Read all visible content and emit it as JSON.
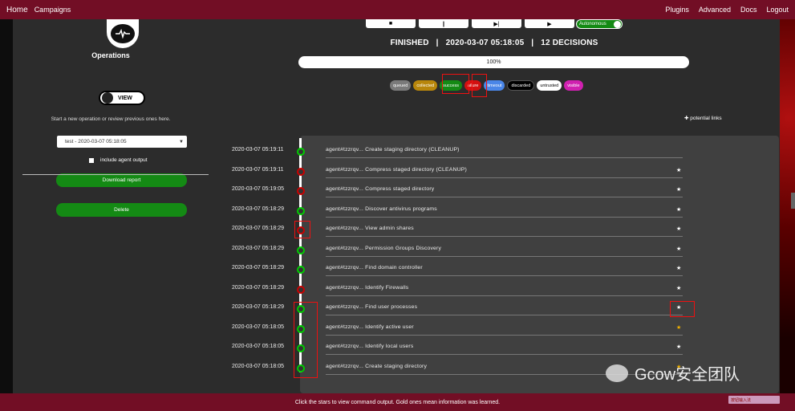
{
  "topnav": {
    "left": [
      "Home",
      "Campaigns"
    ],
    "right": [
      "Plugins",
      "Advanced",
      "Docs",
      "Logout"
    ]
  },
  "left": {
    "title": "Operations",
    "view_label": "VIEW",
    "start_text": "Start a new operation or review previous ones here.",
    "selected_op": "test - 2020-03-07 05:18:05",
    "include_label": "include agent output",
    "download_label": "Download report",
    "delete_label": "Delete"
  },
  "main": {
    "controls": [
      "■",
      "∥",
      "▶|",
      "▶"
    ],
    "autonomous_label": "Autonomous",
    "status": "FINISHED   |   2020-03-07 05:18:05   |   12 DECISIONS",
    "progress": "100%",
    "chips": [
      {
        "label": "queued",
        "color": "#7a7a7a"
      },
      {
        "label": "collected",
        "color": "#b8860b"
      },
      {
        "label": "success",
        "color": "#148a14"
      },
      {
        "label": "ailure",
        "color": "#d21010"
      },
      {
        "label": "timeout",
        "color": "#4a86e8"
      },
      {
        "label": "discarded",
        "color": "#000000"
      },
      {
        "label": "untrusted",
        "color": "#ffffff"
      },
      {
        "label": "visible",
        "color": "#d020b0"
      }
    ],
    "potential_links": "✚ potential links",
    "rows": [
      {
        "date": "2020-03-07 05:19:11",
        "text": "agent#tzzrqv... Create staging directory (CLEANUP)",
        "status": "success",
        "star": ""
      },
      {
        "date": "2020-03-07 05:19:11",
        "text": "agent#tzzrqv... Compress staged directory (CLEANUP)",
        "status": "failure",
        "star": "★"
      },
      {
        "date": "2020-03-07 05:19:05",
        "text": "agent#tzzrqv... Compress staged directory",
        "status": "failure",
        "star": "★"
      },
      {
        "date": "2020-03-07 05:18:29",
        "text": "agent#tzzrqv... Discover antivirus programs",
        "status": "success",
        "star": "★"
      },
      {
        "date": "2020-03-07 05:18:29",
        "text": "agent#tzzrqv... View admin shares",
        "status": "failure",
        "star": "★"
      },
      {
        "date": "2020-03-07 05:18:29",
        "text": "agent#tzzrqv... Permission Groups Discovery",
        "status": "success",
        "star": "★"
      },
      {
        "date": "2020-03-07 05:18:29",
        "text": "agent#tzzrqv... Find domain controller",
        "status": "success",
        "star": "★"
      },
      {
        "date": "2020-03-07 05:18:29",
        "text": "agent#tzzrqv... Identify Firewalls",
        "status": "failure",
        "star": "★"
      },
      {
        "date": "2020-03-07 05:18:29",
        "text": "agent#tzzrqv... Find user processes",
        "status": "success",
        "star": "★"
      },
      {
        "date": "2020-03-07 05:18:05",
        "text": "agent#tzzrqv... Identify active user",
        "status": "success",
        "star": "★",
        "gold": true
      },
      {
        "date": "2020-03-07 05:18:05",
        "text": "agent#tzzrqv... Identify local users",
        "status": "success",
        "star": "★"
      },
      {
        "date": "2020-03-07 05:18:05",
        "text": "agent#tzzrqv... Create staging directory",
        "status": "success",
        "star": "★",
        "gold": true
      }
    ]
  },
  "footer": {
    "hint": "Click the stars to view command output. Gold ones mean information was learned.",
    "ime": "按钮输入法"
  },
  "watermark": "Gcow安全团队"
}
